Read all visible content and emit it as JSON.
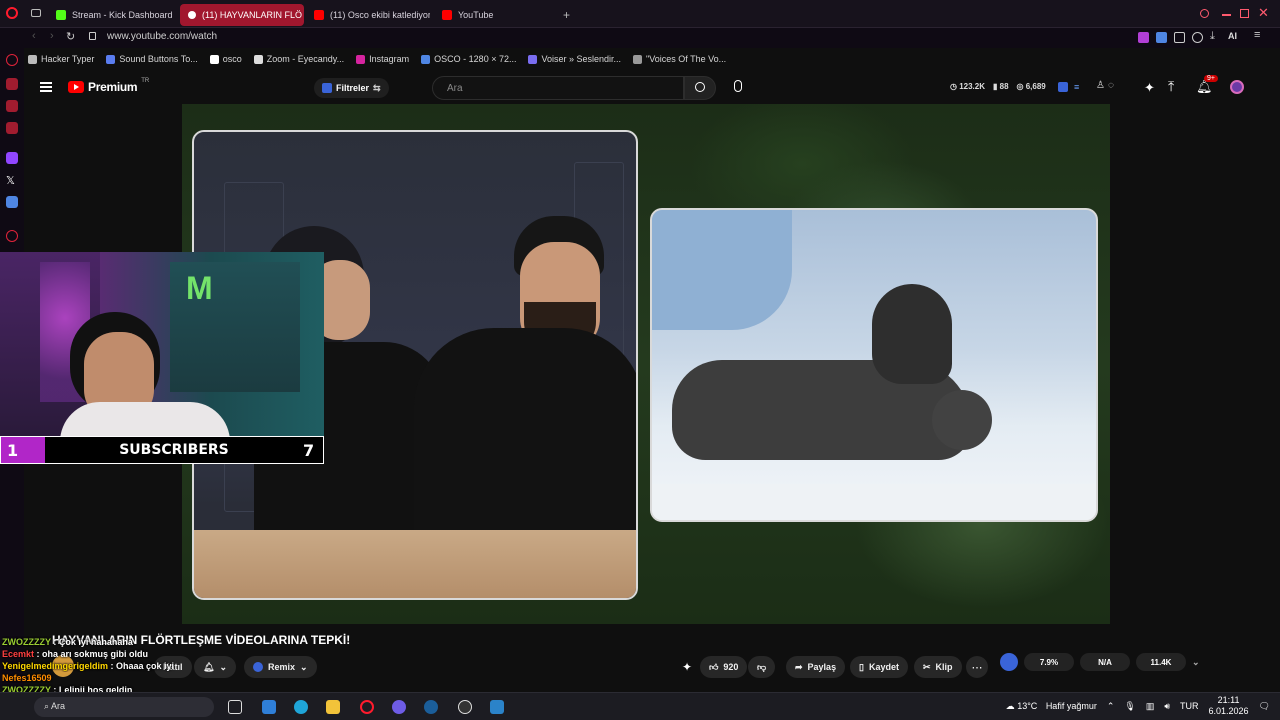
{
  "browser": {
    "tabs": [
      {
        "label": "Stream - Kick Dashboard",
        "color": "#53fc18",
        "active": false
      },
      {
        "label": "(11) HAYVANLARIN FLÖ",
        "color": "#ff0000",
        "active": true
      },
      {
        "label": "(11) Osco ekibi katlediyor",
        "color": "#ff0000",
        "active": false
      },
      {
        "label": "YouTube",
        "color": "#ff0000",
        "active": false
      }
    ],
    "url": "www.youtube.com/watch",
    "bookmarks": [
      {
        "label": "Hacker Typer",
        "icon": "chevron-icon"
      },
      {
        "label": "Sound Buttons To...",
        "icon": "sound-icon"
      },
      {
        "label": "osco",
        "icon": "dot-icon"
      },
      {
        "label": "Zoom - Eyecandy...",
        "icon": "zoom-icon"
      },
      {
        "label": "Instagram",
        "icon": "instagram-icon"
      },
      {
        "label": "OSCO - 1280 × 72...",
        "icon": "osco-icon"
      },
      {
        "label": "Voiser » Seslendir...",
        "icon": "voiser-icon"
      },
      {
        "label": "\"Voices Of The Vo...",
        "icon": "folder-icon"
      }
    ],
    "toolbar_ai": "AI"
  },
  "youtube": {
    "logo_text": "Premium",
    "logo_region": "TR",
    "filters_label": "Filtreler",
    "search_placeholder": "Ara",
    "header_stats": {
      "views": "123.2K",
      "likes": "88",
      "viewers": "6,689"
    },
    "notification_badge": "9+"
  },
  "overlay": {
    "subs_left": "1",
    "subs_label": "SUBSCRIBERS",
    "subs_right": "7"
  },
  "video": {
    "title": "HAYVANLARIN FLÖRTLEŞME VİDEOLARINA TEPKİ!",
    "join_label": "Katıl",
    "remix_label": "Remix",
    "like_count": "920",
    "share_label": "Paylaş",
    "save_label": "Kaydet",
    "clip_label": "Klip",
    "stats": [
      "7.9%",
      "N/A",
      "11.4K"
    ]
  },
  "chat": [
    {
      "user": "ZWOZZZZY",
      "message": "Çok iyi hahahaha",
      "color": "#9acd32"
    },
    {
      "user": "Ecemkt",
      "message": "oha arı sokmuş gibi oldu",
      "color": "#ff4040"
    },
    {
      "user": "Yenigelmedimgerigeldim",
      "message": "Ohaaa çok iyi",
      "color": "#ffd700"
    },
    {
      "user": "Nefes16509",
      "message": "",
      "color": "#ff8c00"
    },
    {
      "user": "ZWOZZZZY",
      "message": "Lelinii hoş geldin",
      "color": "#9acd32"
    }
  ],
  "taskbar": {
    "search_label": "Ara",
    "weather": "13°C",
    "weather_desc": "Hafif yağmur",
    "lang": "TUR",
    "time": "21:11",
    "date": "6.01.2026"
  }
}
